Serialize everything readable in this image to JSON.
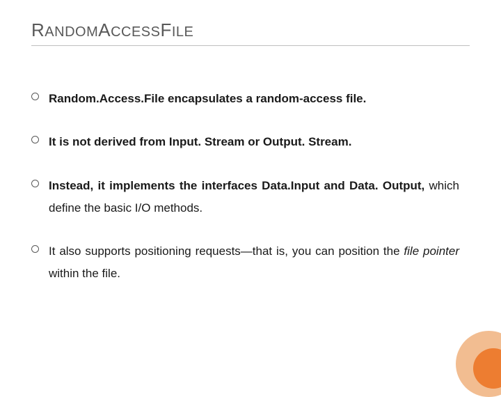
{
  "title": {
    "parts": [
      {
        "class": "big",
        "text": "R"
      },
      {
        "class": "small",
        "text": "ANDOM"
      },
      {
        "class": "big",
        "text": "A"
      },
      {
        "class": "small",
        "text": "CCESS"
      },
      {
        "class": "big",
        "text": "F"
      },
      {
        "class": "small",
        "text": "ILE"
      }
    ]
  },
  "bullets": [
    {
      "segments": [
        {
          "text": "Random.Access.File encapsulates a random-access file.",
          "bold": true
        }
      ]
    },
    {
      "segments": [
        {
          "text": "It is not derived from Input. Stream or Output. Stream.",
          "bold": true
        }
      ]
    },
    {
      "segments": [
        {
          "text": "Instead, it implements the interfaces Data.Input and Data. Output, ",
          "bold": true
        },
        {
          "text": "which define the basic I/O methods.",
          "bold": false
        }
      ]
    },
    {
      "segments": [
        {
          "text": "It also supports positioning requests—that is, you can position the ",
          "bold": false
        },
        {
          "text": "file pointer ",
          "bold": false,
          "italic": true
        },
        {
          "text": "within the file.",
          "bold": false
        }
      ]
    }
  ]
}
